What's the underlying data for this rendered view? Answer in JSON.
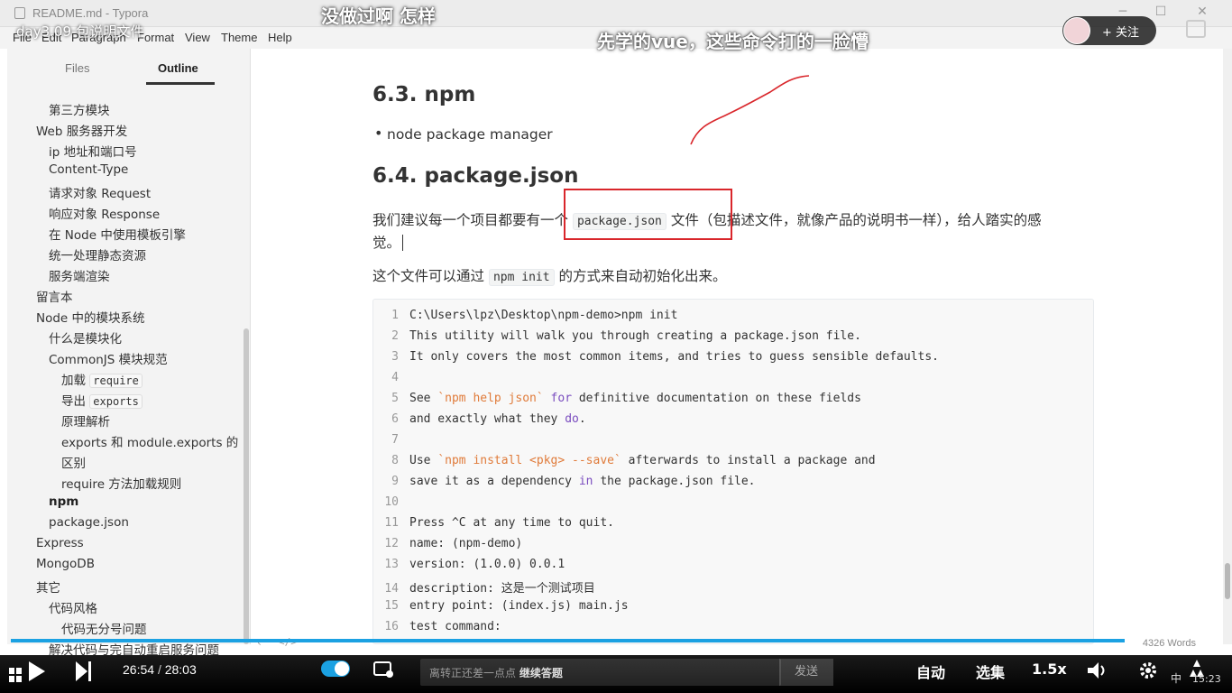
{
  "window": {
    "title": "README.md - Typora"
  },
  "menu": [
    "File",
    "Edit",
    "Paragraph",
    "Format",
    "View",
    "Theme",
    "Help"
  ],
  "video": {
    "title": "day3.09-包说明文件",
    "current_time": "26:54",
    "total_time": "28:03",
    "follow_label": "+ 关注",
    "danmaku": [
      "没做过啊  怎样",
      "先学的vue，这些命令打的一脸懵"
    ],
    "input_placeholder_prefix": "离转正还差一点点",
    "input_placeholder_action": "继续答题",
    "send_label": "发送",
    "auto_label": "自动",
    "episodes_label": "选集",
    "speed_label": "1.5x",
    "progress_fraction": 0.959,
    "clock": "15:23",
    "ime": "中"
  },
  "sidebar": {
    "tabs": [
      "Files",
      "Outline"
    ],
    "items": [
      {
        "text": "第三方模块",
        "indent": 2
      },
      {
        "text": "Web 服务器开发",
        "indent": 1
      },
      {
        "text": "ip 地址和端口号",
        "indent": 2
      },
      {
        "text": "Content-Type",
        "indent": 2
      },
      {
        "text": "请求对象 Request",
        "indent": 2
      },
      {
        "text": "响应对象 Response",
        "indent": 2
      },
      {
        "text": "在 Node 中使用模板引擎",
        "indent": 2
      },
      {
        "text": "统一处理静态资源",
        "indent": 2
      },
      {
        "text": "服务端渲染",
        "indent": 2
      },
      {
        "text": "留言本",
        "indent": 1
      },
      {
        "text": "Node 中的模块系统",
        "indent": 1
      },
      {
        "text": "什么是模块化",
        "indent": 2
      },
      {
        "text": "CommonJS 模块规范",
        "indent": 2
      },
      {
        "text": "加载",
        "code": "require",
        "indent": 3
      },
      {
        "text": "导出",
        "code": "exports",
        "indent": 3
      },
      {
        "text": "原理解析",
        "indent": 3
      },
      {
        "text": "exports 和 module.exports 的",
        "indent": 3
      },
      {
        "text": "区别",
        "indent": 3
      },
      {
        "text": "require 方法加载规则",
        "indent": 3
      },
      {
        "text": "npm",
        "indent": 2,
        "bold": true
      },
      {
        "text": "package.json",
        "indent": 2
      },
      {
        "text": "Express",
        "indent": 1
      },
      {
        "text": "MongoDB",
        "indent": 1
      },
      {
        "text": "其它",
        "indent": 1
      },
      {
        "text": "代码风格",
        "indent": 2
      },
      {
        "text": "代码无分号问题",
        "indent": 3
      },
      {
        "text": "解决代码与完自动重启服务问题",
        "indent": 2
      }
    ]
  },
  "content": {
    "h_npm": "6.3. npm",
    "bullet_npm": "node package manager",
    "h_pkg": "6.4. package.json",
    "p1_before": "我们建议每一个项目都要有一个",
    "p1_code": "package.json",
    "p1_after": "文件（包描述文件，就像产品的说明书一样），给人踏实的感",
    "p1_line2": "觉。",
    "p2_before": "这个文件可以通过",
    "p2_code": "npm init",
    "p2_after": "的方式来自动初始化出来。",
    "code_lines": [
      {
        "n": "1",
        "parts": [
          {
            "t": "C:\\Users\\lpz\\Desktop\\npm-demo>npm init"
          }
        ]
      },
      {
        "n": "2",
        "parts": [
          {
            "t": "This utility will walk you through creating a package.json file."
          }
        ]
      },
      {
        "n": "3",
        "parts": [
          {
            "t": "It only covers the most common items, and tries to guess sensible defaults."
          }
        ]
      },
      {
        "n": "4",
        "parts": [
          {
            "t": ""
          }
        ]
      },
      {
        "n": "5",
        "parts": [
          {
            "t": "See "
          },
          {
            "t": "`npm help json`",
            "c": "str"
          },
          {
            "t": " "
          },
          {
            "t": "for",
            "c": "kw"
          },
          {
            "t": " definitive documentation on these fields"
          }
        ]
      },
      {
        "n": "6",
        "parts": [
          {
            "t": "and exactly what they "
          },
          {
            "t": "do",
            "c": "kw"
          },
          {
            "t": "."
          }
        ]
      },
      {
        "n": "7",
        "parts": [
          {
            "t": ""
          }
        ]
      },
      {
        "n": "8",
        "parts": [
          {
            "t": "Use "
          },
          {
            "t": "`npm install <pkg> --save`",
            "c": "str"
          },
          {
            "t": " afterwards to install a package and"
          }
        ]
      },
      {
        "n": "9",
        "parts": [
          {
            "t": "save it as a dependency "
          },
          {
            "t": "in",
            "c": "kw"
          },
          {
            "t": " the package.json file."
          }
        ]
      },
      {
        "n": "10",
        "parts": [
          {
            "t": ""
          }
        ]
      },
      {
        "n": "11",
        "parts": [
          {
            "t": "Press ^C at any time to quit."
          }
        ]
      },
      {
        "n": "12",
        "parts": [
          {
            "t": "name: (npm-demo)"
          }
        ]
      },
      {
        "n": "13",
        "parts": [
          {
            "t": "version: (1.0.0) 0.0.1"
          }
        ]
      },
      {
        "n": "14",
        "parts": [
          {
            "t": "description: 这是一个测试项目"
          }
        ]
      },
      {
        "n": "15",
        "parts": [
          {
            "t": "entry point: (index.js) main.js"
          }
        ]
      },
      {
        "n": "16",
        "parts": [
          {
            "t": "test command:"
          }
        ]
      }
    ]
  },
  "status": {
    "word_count": "4326 Words"
  }
}
